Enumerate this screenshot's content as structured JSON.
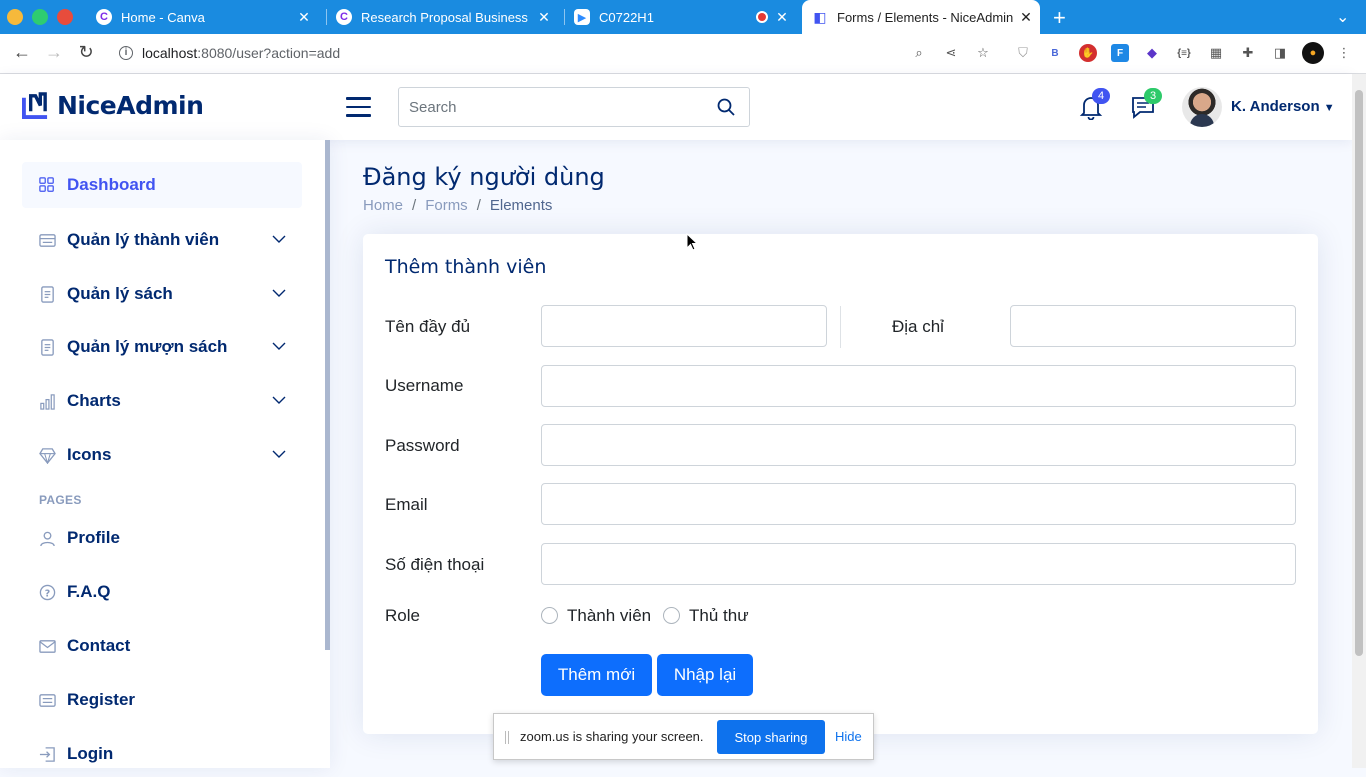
{
  "browser": {
    "tabs": [
      {
        "title": "Home - Canva",
        "icon": "canva-icon",
        "color": "#7d2ae8"
      },
      {
        "title": "Research Proposal Business P",
        "icon": "canva-icon",
        "color": "#7d2ae8"
      },
      {
        "title": "C0722H1",
        "icon": "zoom-icon",
        "color": "#2d8cff"
      },
      {
        "title": "Forms / Elements - NiceAdmin",
        "icon": "niceadmin-icon",
        "color": "#4154f1"
      }
    ],
    "url_host": "localhost",
    "url_rest": ":8080/user?action=add"
  },
  "header": {
    "logo_text": "NiceAdmin",
    "search_placeholder": "Search",
    "notifications_count": "4",
    "messages_count": "3",
    "user_name": "K. Anderson",
    "colors": {
      "notif_badge": "#4154f1",
      "msg_badge": "#2eca6a"
    }
  },
  "sidebar": {
    "items": [
      {
        "label": "Dashboard",
        "icon": "grid-icon"
      },
      {
        "label": "Quản lý thành viên",
        "icon": "card-icon"
      },
      {
        "label": "Quản lý sách",
        "icon": "journal-icon"
      },
      {
        "label": "Quản lý mượn sách",
        "icon": "journal-icon"
      },
      {
        "label": "Charts",
        "icon": "bar-chart-icon"
      },
      {
        "label": "Icons",
        "icon": "gem-icon"
      }
    ],
    "pages_heading": "PAGES",
    "pages": [
      {
        "label": "Profile",
        "icon": "person-icon"
      },
      {
        "label": "F.A.Q",
        "icon": "question-icon"
      },
      {
        "label": "Contact",
        "icon": "envelope-icon"
      },
      {
        "label": "Register",
        "icon": "card-icon"
      },
      {
        "label": "Login",
        "icon": "login-icon"
      }
    ]
  },
  "main": {
    "page_title": "Đăng ký người dùng",
    "breadcrumb": [
      "Home",
      "Forms",
      "Elements"
    ],
    "card_title": "Thêm thành viên",
    "form": {
      "fullname_label": "Tên đầy đủ",
      "address_label": "Địa chỉ",
      "username_label": "Username",
      "password_label": "Password",
      "email_label": "Email",
      "phone_label": "Số điện thoại",
      "role_label": "Role",
      "role_options": [
        "Thành viên",
        "Thủ thư"
      ],
      "submit_label": "Thêm mới",
      "reset_label": "Nhập lại"
    }
  },
  "zoom": {
    "message": "zoom.us is sharing your screen.",
    "stop_label": "Stop sharing",
    "hide_label": "Hide"
  }
}
